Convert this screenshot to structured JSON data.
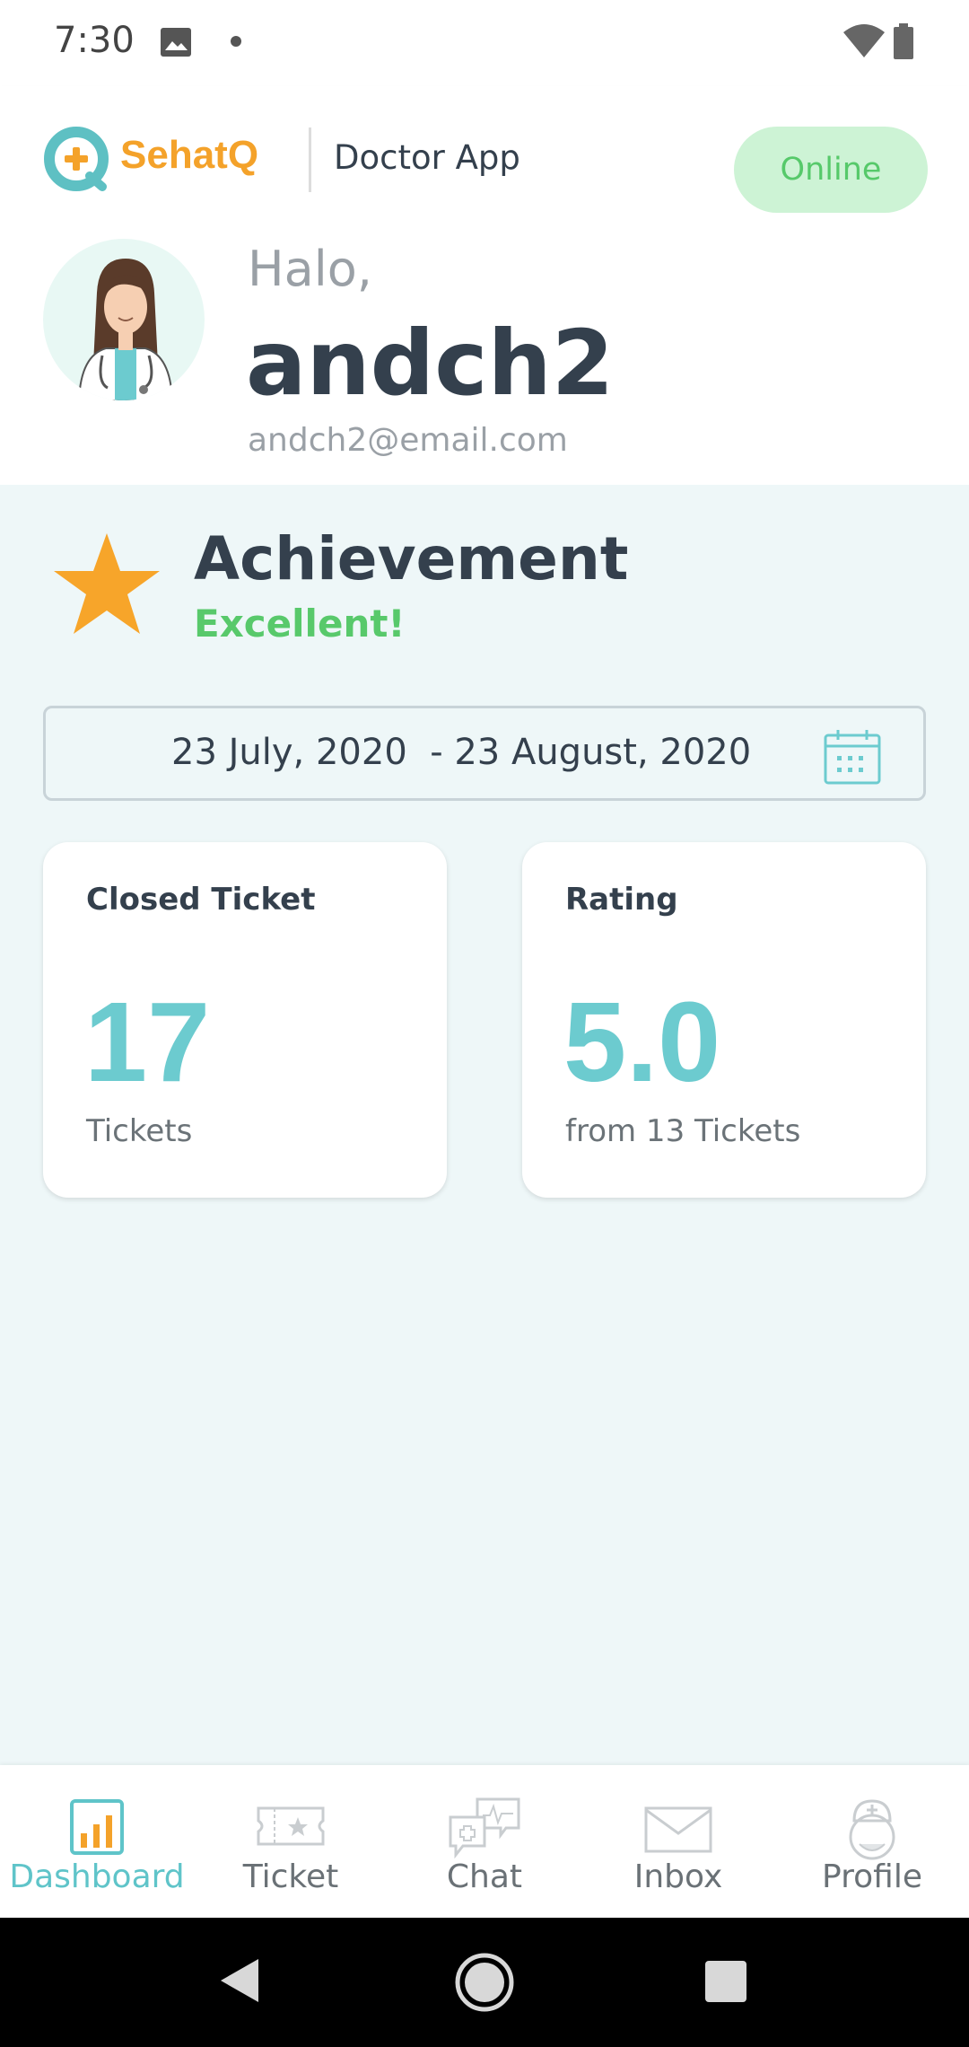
{
  "status_bar": {
    "time": "7:30"
  },
  "header": {
    "brand": "SehatQ",
    "subtitle": "Doctor App",
    "status_pill": "Online",
    "greeting": "Halo,",
    "username": "andch2",
    "email": "andch2@email.com"
  },
  "achievement": {
    "title": "Achievement",
    "status": "Excellent!",
    "date_range": "23 July, 2020  - 23 August, 2020"
  },
  "cards": {
    "closed": {
      "title": "Closed Ticket",
      "value": "17",
      "sub": "Tickets"
    },
    "rating": {
      "title": "Rating",
      "value": "5.0",
      "sub": "from 13 Tickets"
    }
  },
  "nav": {
    "items": [
      {
        "label": "Dashboard",
        "icon": "bar-chart-icon",
        "active": true
      },
      {
        "label": "Ticket",
        "icon": "ticket-icon",
        "active": false
      },
      {
        "label": "Chat",
        "icon": "chat-icon",
        "active": false
      },
      {
        "label": "Inbox",
        "icon": "envelope-icon",
        "active": false
      },
      {
        "label": "Profile",
        "icon": "doctor-icon",
        "active": false
      }
    ]
  },
  "colors": {
    "accent_teal": "#6ccbcf",
    "brand_orange": "#f4a22a",
    "online_green": "#56c96a",
    "background": "#eef7f8"
  }
}
